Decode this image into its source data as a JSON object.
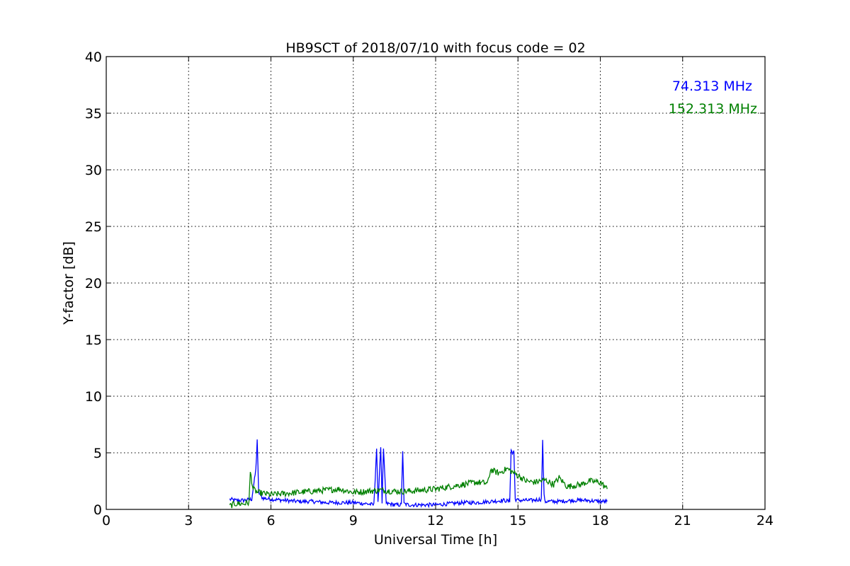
{
  "chart_data": {
    "type": "line",
    "title": "HB9SCT of 2018/07/10 with focus code = 02",
    "xlabel": "Universal Time [h]",
    "ylabel": "Y-factor [dB]",
    "xlim": [
      0,
      24
    ],
    "ylim": [
      0,
      40
    ],
    "xticks": [
      "0",
      "3",
      "6",
      "9",
      "12",
      "15",
      "18",
      "21",
      "24"
    ],
    "yticks": [
      "0",
      "5",
      "10",
      "15",
      "20",
      "25",
      "30",
      "35",
      "40"
    ],
    "grid": true,
    "legend_placement": "top-right",
    "series": [
      {
        "name": "74.313 MHz",
        "color": "#0000ff",
        "x": [
          4.5,
          4.7,
          5.0,
          5.3,
          5.45,
          5.5,
          5.55,
          5.7,
          6.0,
          6.5,
          7.0,
          7.5,
          8.0,
          8.5,
          9.0,
          9.5,
          9.75,
          9.85,
          9.9,
          10.0,
          10.05,
          10.1,
          10.2,
          10.3,
          10.5,
          10.75,
          10.8,
          10.85,
          11.0,
          11.5,
          12.0,
          12.5,
          13.0,
          13.5,
          14.0,
          14.5,
          14.7,
          14.75,
          14.8,
          14.85,
          14.9,
          15.0,
          15.5,
          15.85,
          15.9,
          15.95,
          16.0,
          16.5,
          17.0,
          17.5,
          18.0,
          18.25
        ],
        "y": [
          0.9,
          0.8,
          0.8,
          0.9,
          3.5,
          6.2,
          1.5,
          1.0,
          0.9,
          0.8,
          0.7,
          0.7,
          0.6,
          0.6,
          0.6,
          0.5,
          0.4,
          5.4,
          0.5,
          5.6,
          0.6,
          5.3,
          0.5,
          0.5,
          0.4,
          0.4,
          5.2,
          0.5,
          0.4,
          0.4,
          0.4,
          0.5,
          0.6,
          0.6,
          0.7,
          0.8,
          0.7,
          5.3,
          4.9,
          5.2,
          0.9,
          0.8,
          0.8,
          0.9,
          6.0,
          1.2,
          0.7,
          0.7,
          0.8,
          0.8,
          0.7,
          0.7
        ]
      },
      {
        "name": "152.313 MHz",
        "color": "#008000",
        "x": [
          4.5,
          4.7,
          5.0,
          5.2,
          5.25,
          5.35,
          5.5,
          6.0,
          6.5,
          7.0,
          7.5,
          8.0,
          8.5,
          9.0,
          9.5,
          10.0,
          10.5,
          11.0,
          11.5,
          12.0,
          12.5,
          13.0,
          13.5,
          13.9,
          14.0,
          14.3,
          14.6,
          14.8,
          15.0,
          15.3,
          15.6,
          16.0,
          16.3,
          16.5,
          16.8,
          17.0,
          17.3,
          17.6,
          18.0,
          18.25
        ],
        "y": [
          0.3,
          0.5,
          0.5,
          0.6,
          3.3,
          1.8,
          1.5,
          1.3,
          1.4,
          1.5,
          1.6,
          1.7,
          1.8,
          1.5,
          1.6,
          1.7,
          1.6,
          1.6,
          1.7,
          1.8,
          2.0,
          2.2,
          2.4,
          2.3,
          3.5,
          3.2,
          3.6,
          3.3,
          3.0,
          2.5,
          2.4,
          2.6,
          2.2,
          2.8,
          2.0,
          2.1,
          2.2,
          2.5,
          2.4,
          1.8
        ]
      }
    ]
  }
}
